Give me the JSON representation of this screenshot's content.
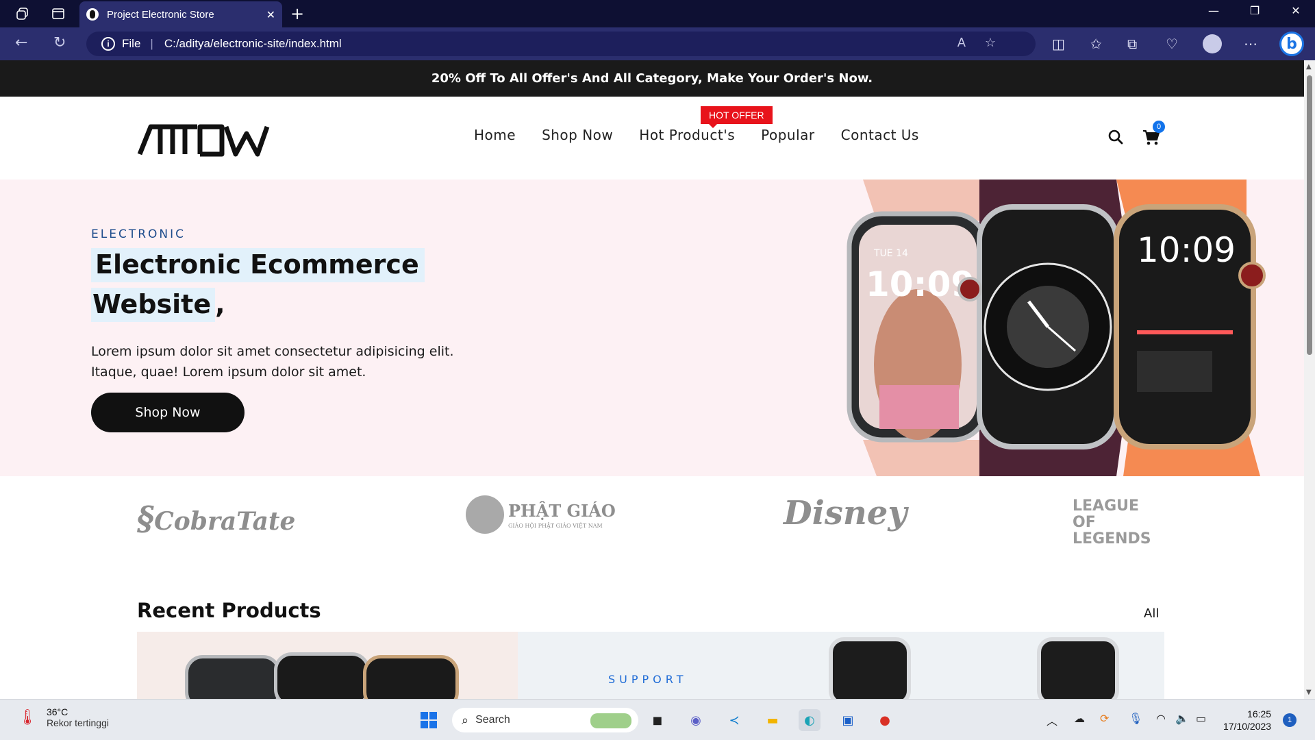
{
  "browser": {
    "tab_title": "Project Electronic Store",
    "url_scheme": "File",
    "url": "C:/aditya/electronic-site/index.html"
  },
  "site": {
    "promo_text": "20% Off To All Offer's And All Category, Make Your Order's Now.",
    "nav": {
      "home": "Home",
      "shop_now": "Shop Now",
      "hot_products": "Hot Product's",
      "popular": "Popular",
      "contact": "Contact Us",
      "hot_badge": "HOT OFFER"
    },
    "cart_count": "0",
    "hero": {
      "eyebrow": "ELECTRONIC",
      "title_line1": "Electronic Ecommerce",
      "title_line2": "Website",
      "title_suffix": ",",
      "text": "Lorem ipsum dolor sit amet consectetur adipisicing elit. Itaque, quae! Lorem ipsum dolor sit amet.",
      "button": "Shop Now",
      "watch1_date": "TUE 14",
      "watch1_time": "10:09",
      "watch3_time": "10:09"
    },
    "brands": [
      "CobraTate",
      "PHẬT GIÁO",
      "Disney",
      "LEAGUE OF LEGENDS"
    ],
    "brand_sub": "GIÁO HỘI PHẬT GIÁO VIỆT NAM",
    "recent": {
      "title": "Recent Products",
      "all_link": "All",
      "support_label": "SUPPORT"
    }
  },
  "taskbar": {
    "temperature": "36°C",
    "weather_desc": "Rekor tertinggi",
    "search_placeholder": "Search",
    "time": "16:25",
    "date": "17/10/2023",
    "notification_count": "1"
  },
  "colors": {
    "chrome_dark": "#0e1033",
    "chrome_bar": "#2b2e6e",
    "promo_bg": "#1a1a1a",
    "hero_bg": "#fdf1f4",
    "accent_blue": "#1d4c8c",
    "hot_red": "#e8131b"
  }
}
